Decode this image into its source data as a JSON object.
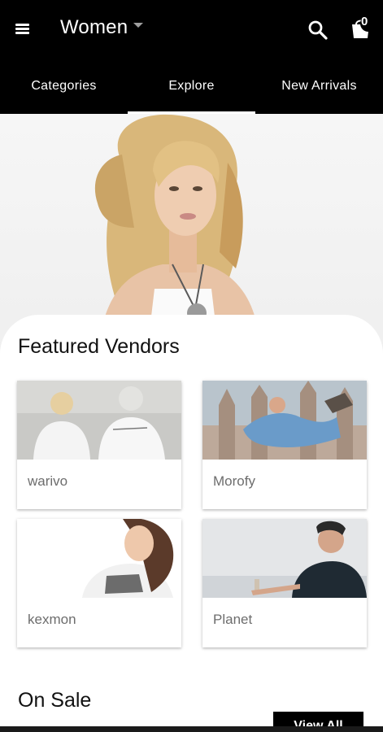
{
  "header": {
    "title": "Women",
    "cart_count": "0"
  },
  "tabs": [
    {
      "label": "Categories"
    },
    {
      "label": "Explore"
    },
    {
      "label": "New Arrivals"
    }
  ],
  "sections": {
    "featured_title": "Featured Vendors",
    "sale_title": "On Sale",
    "view_all_label": "View All"
  },
  "vendors": [
    {
      "name": "warivo"
    },
    {
      "name": "Morofy"
    },
    {
      "name": "kexmon"
    },
    {
      "name": "Planet"
    }
  ],
  "colors": {
    "appbar": "#000000",
    "accent": "#ffffff",
    "card_label": "#6d6d6d"
  }
}
